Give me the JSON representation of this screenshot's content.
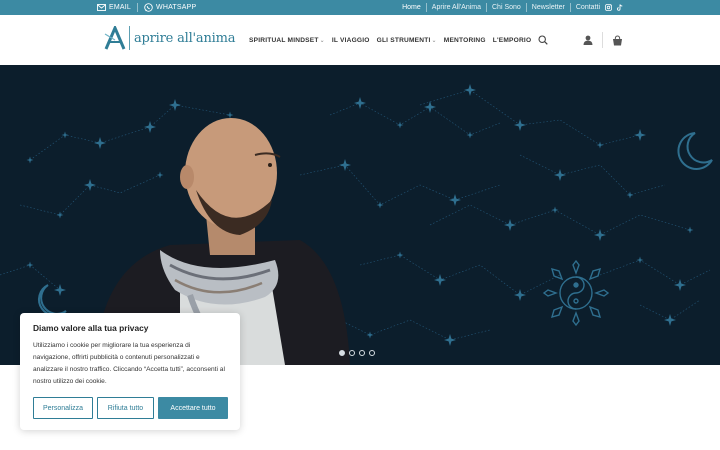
{
  "topbar": {
    "email_label": "EMAIL",
    "whatsapp_label": "WHATSAPP",
    "links": [
      "Home",
      "Aprire All'Anima",
      "Chi Sono",
      "Newsletter",
      "Contatti"
    ]
  },
  "header": {
    "logo_text": "aprire all'anima",
    "nav": [
      "SPIRITUAL MINDSET",
      "IL VIAGGIO",
      "GLI STRUMENTI",
      "MENTORING",
      "L'EMPORIO"
    ]
  },
  "hero": {
    "slides_count": 4,
    "active_slide": 1
  },
  "cookie": {
    "title": "Diamo valore alla tua privacy",
    "text": "Utilizziamo i cookie per migliorare la tua esperienza di navigazione, offrirti pubblicità o contenuti personalizzati e analizzare il nostro traffico. Cliccando “Accetta tutti”, acconsenti al nostro utilizzo dei cookie.",
    "customize_label": "Personalizza",
    "reject_label": "Rifiuta tutto",
    "accept_label": "Accettare tutto"
  },
  "colors": {
    "brand": "#3c8aa3",
    "hero_bg": "#0c1e2c",
    "star": "#2f6f8f"
  }
}
